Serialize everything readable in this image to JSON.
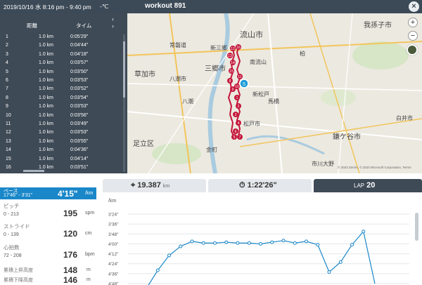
{
  "header": {
    "date": "2019/10/16 水 8:16 pm - 9:40 pm",
    "temperature": "-℃",
    "title": "workout 891",
    "close_icon": "close-icon"
  },
  "laps": {
    "col_distance": "距離",
    "col_time": "タイム",
    "arrows": "‹ ›",
    "rows": [
      {
        "n": "1",
        "dist": "1.0 km",
        "time": "0:05'29\""
      },
      {
        "n": "2",
        "dist": "1.0 km",
        "time": "0:04'44\""
      },
      {
        "n": "3",
        "dist": "1.0 km",
        "time": "0:04'18\""
      },
      {
        "n": "4",
        "dist": "1.0 km",
        "time": "0:03'57\""
      },
      {
        "n": "5",
        "dist": "1.0 km",
        "time": "0:03'50\""
      },
      {
        "n": "6",
        "dist": "1.0 km",
        "time": "0:03'53\""
      },
      {
        "n": "7",
        "dist": "1.0 km",
        "time": "0:03'52\""
      },
      {
        "n": "8",
        "dist": "1.0 km",
        "time": "0:03'54\""
      },
      {
        "n": "9",
        "dist": "1.0 km",
        "time": "0:03'53\""
      },
      {
        "n": "10",
        "dist": "1.0 km",
        "time": "0:03'56\""
      },
      {
        "n": "11",
        "dist": "1.0 km",
        "time": "0:03'49\""
      },
      {
        "n": "12",
        "dist": "1.0 km",
        "time": "0:03'53\""
      },
      {
        "n": "13",
        "dist": "1.0 km",
        "time": "0:03'55\""
      },
      {
        "n": "14",
        "dist": "1.0 km",
        "time": "0:04'36\""
      },
      {
        "n": "15",
        "dist": "1.0 km",
        "time": "0:04'14\""
      },
      {
        "n": "16",
        "dist": "1.0 km",
        "time": "0:03'51\""
      }
    ]
  },
  "map": {
    "labels": [
      "流山市",
      "我孫子市",
      "三郷市",
      "草加市",
      "八潮市",
      "松戸市",
      "鎌ケ谷市",
      "足立区",
      "白井市",
      "市川大野",
      "金町",
      "八潮",
      "新三郷",
      "南流山",
      "馬橋",
      "新松戸",
      "常磐道",
      "柏"
    ],
    "route_markers": [
      "5",
      "12",
      "13",
      "14",
      "15",
      "1",
      "2",
      "3",
      "4",
      "6",
      "7",
      "8",
      "9",
      "10",
      "11",
      "16"
    ],
    "current_marker": "5",
    "copyright": "© 2023 Zenrin, © 2023 Microsoft Corporation, Terms",
    "route_color": "#c4163a",
    "zoom_in": "+",
    "zoom_out": "−"
  },
  "metrics": {
    "pace": {
      "label": "ペース",
      "range": "17'46\" - 3'31\"",
      "value": "4'15\"",
      "unit": "/km"
    },
    "pitch": {
      "label": "ピッチ",
      "range": "0 - 213",
      "value": "195",
      "unit": "spm"
    },
    "stride": {
      "label": "ストライド",
      "range": "0 - 139",
      "value": "120",
      "unit": "cm"
    },
    "heart": {
      "label": "心拍数",
      "range": "72 - 208",
      "value": "176",
      "unit": "bpm"
    },
    "ascent": {
      "label": "累積上昇高度",
      "value": "148",
      "unit": "m"
    },
    "descent": {
      "label": "累積下降高度",
      "value": "146",
      "unit": "m"
    }
  },
  "stats": {
    "distance": "19.387",
    "distance_unit": "km",
    "duration": "1:22'26\"",
    "lap_label": "LAP",
    "lap_value": "20"
  },
  "accent_color": "#1a87c9",
  "chart_data": {
    "type": "line",
    "ylabel": "/km",
    "y_ticks": [
      "3'24\"",
      "3'36\"",
      "3'48\"",
      "4'00\"",
      "4'12\"",
      "4'24\"",
      "4'36\"",
      "4'48\""
    ],
    "y_tick_seconds": [
      204,
      216,
      228,
      240,
      252,
      264,
      276,
      288
    ],
    "ylim": [
      204,
      288
    ],
    "y_inverted": true,
    "series": [
      {
        "values": [
          294,
          272,
          254,
          243,
          237,
          239,
          239,
          238,
          239,
          239,
          240,
          238,
          236,
          239,
          237,
          241,
          274,
          262,
          241,
          225,
          288
        ]
      }
    ]
  }
}
